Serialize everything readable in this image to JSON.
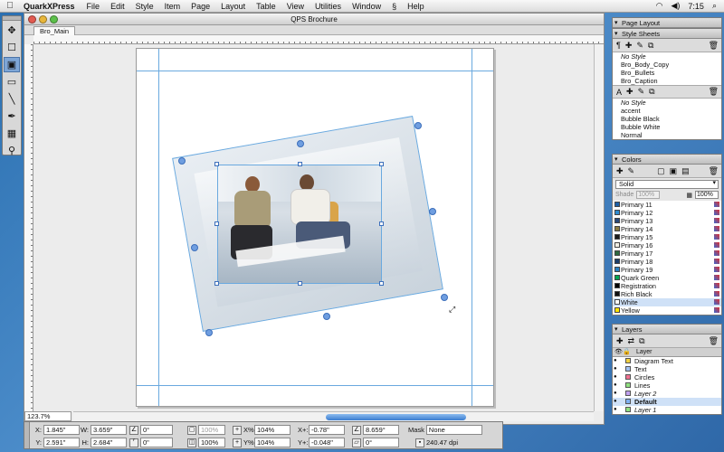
{
  "menubar": {
    "app": "QuarkXPress",
    "menus": [
      "File",
      "Edit",
      "Style",
      "Item",
      "Page",
      "Layout",
      "Table",
      "View",
      "Utilities",
      "Window",
      "Help"
    ],
    "clock": "7:15"
  },
  "document": {
    "title": "QPS Brochure",
    "tab": "Bro_Main",
    "zoom": "123.7%"
  },
  "measurements": {
    "x": "1.845\"",
    "y": "2.591\"",
    "w": "3.659\"",
    "h": "2.684\"",
    "angle": "0°",
    "corner": "0\"",
    "opacity1": "100%",
    "opacity2": "100%",
    "scale_x": "104%",
    "scale_y": "104%",
    "offset_x": "-0.78\"",
    "offset_y": "-0.048\"",
    "pic_angle": "8.659°",
    "pic_skew": "0°",
    "mask": "None",
    "resolution": "240.47 dpi"
  },
  "palettes": {
    "page_layout": "Page Layout",
    "style_sheets": {
      "title": "Style Sheets",
      "paragraph": [
        "No Style",
        "Bro_Body_Copy",
        "Bro_Bullets",
        "Bro_Caption"
      ],
      "character": [
        "No Style",
        "accent",
        "Bubble Black",
        "Bubble White",
        "Normal"
      ]
    },
    "colors": {
      "title": "Colors",
      "mode": "Solid",
      "shade_label": "Shade",
      "shade": "100%",
      "shade2": "100%",
      "items": [
        {
          "name": "Primary 11",
          "color": "#1d5fa6"
        },
        {
          "name": "Primary 12",
          "color": "#2e8bd0"
        },
        {
          "name": "Primary 13",
          "color": "#2a4a7a"
        },
        {
          "name": "Primary 14",
          "color": "#8a7a40"
        },
        {
          "name": "Primary 15",
          "color": "#1a1a1a"
        },
        {
          "name": "Primary 16",
          "color": "#f2efe4"
        },
        {
          "name": "Primary 17",
          "color": "#2f6a40"
        },
        {
          "name": "Primary 18",
          "color": "#1f3f6a"
        },
        {
          "name": "Primary 19",
          "color": "#2a7fc0"
        },
        {
          "name": "Quark Green",
          "color": "#00a651"
        },
        {
          "name": "Registration",
          "color": "#000000"
        },
        {
          "name": "Rich Black",
          "color": "#111111"
        },
        {
          "name": "White",
          "color": "#ffffff"
        },
        {
          "name": "Yellow",
          "color": "#ffe400"
        }
      ]
    },
    "layers": {
      "title": "Layers",
      "header": "Layer",
      "items": [
        {
          "name": "Diagram Text",
          "color": "#f0d040"
        },
        {
          "name": "Text",
          "color": "#a0c0f0"
        },
        {
          "name": "Circles",
          "color": "#f07090"
        },
        {
          "name": "Lines",
          "color": "#90e080"
        },
        {
          "name": "Layer 2",
          "color": "#c0a0f0"
        },
        {
          "name": "Default",
          "color": "#7fb0f0"
        },
        {
          "name": "Layer 1",
          "color": "#90e080"
        }
      ]
    }
  }
}
